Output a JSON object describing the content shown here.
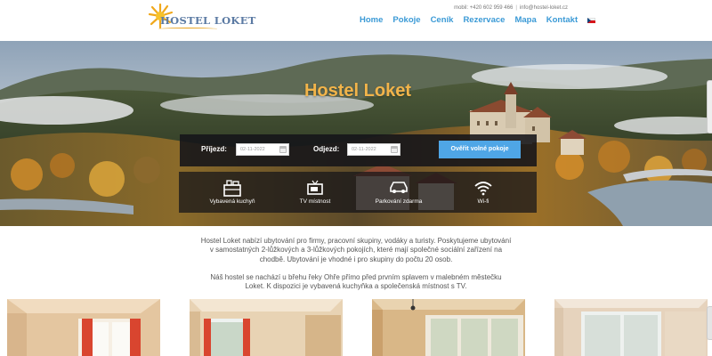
{
  "header": {
    "logo_text": "HOSTEL LOKET",
    "phone": "mobil: +420 602 959 466",
    "email": "info@hostel-loket.cz",
    "nav": [
      {
        "label": "Home"
      },
      {
        "label": "Pokoje"
      },
      {
        "label": "Ceník"
      },
      {
        "label": "Rezervace"
      },
      {
        "label": "Mapa"
      },
      {
        "label": "Kontakt"
      }
    ],
    "language_flag": "czech-flag-icon",
    "colors": {
      "nav": "#3b9ad6",
      "logo": "#5b7aa3",
      "accent": "#e9a11a"
    }
  },
  "hero": {
    "title": "Hostel Loket",
    "title_color": "#f2b44a",
    "booking": {
      "arrival_label": "Příjezd:",
      "arrival_value": "02-11-2022",
      "departure_label": "Odjezd:",
      "departure_value": "02-11-2022",
      "check_button": "Ověřit volné pokoje",
      "button_color": "#4fa6e6"
    },
    "features": [
      {
        "icon": "kitchen-icon",
        "label": "Vybavená kuchyň"
      },
      {
        "icon": "tv-icon",
        "label": "TV místnost"
      },
      {
        "icon": "car-icon",
        "label": "Parkování zdarma"
      },
      {
        "icon": "wifi-icon",
        "label": "Wi-fi"
      }
    ]
  },
  "intro": {
    "paragraph1": "Hostel Loket nabízí ubytování pro firmy, pracovní skupiny, vodáky a turisty. Poskytujeme ubytování v samostatných 2-lůžkových a 3-lůžkových pokojích, které mají společné sociální zařízení na chodbě. Ubytování je vhodné i pro skupiny do počtu 20 osob.",
    "paragraph2": "Náš hostel se nachází u břehu řeky Ohře přímo před prvním splavem v malebném městečku Loket. K dispozici je vybavená kuchyňka a společenská místnost s TV."
  },
  "photos": [
    {
      "name": "room-photo-1"
    },
    {
      "name": "room-photo-2"
    },
    {
      "name": "room-photo-3"
    },
    {
      "name": "room-photo-4"
    }
  ]
}
